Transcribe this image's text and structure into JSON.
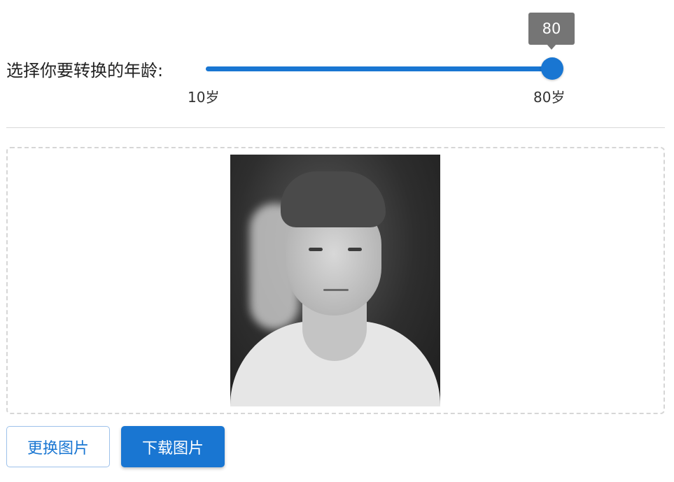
{
  "age_selector": {
    "label": "选择你要转换的年龄:",
    "min": 10,
    "max": 80,
    "value": 80,
    "value_display": "80",
    "min_label": "10岁",
    "max_label": "80岁",
    "accent_color": "#1976d2"
  },
  "preview": {
    "image_description_icon": "portrait-photo"
  },
  "actions": {
    "change_image_label": "更换图片",
    "download_image_label": "下载图片"
  }
}
